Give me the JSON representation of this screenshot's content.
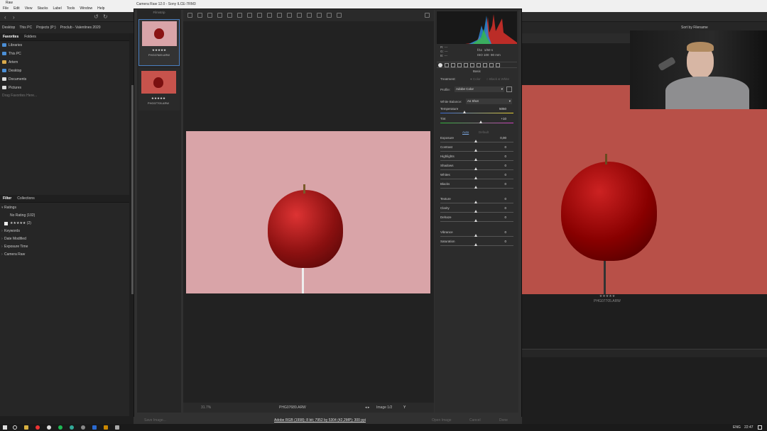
{
  "bridge": {
    "title": "Raw",
    "menu": [
      "File",
      "Edit",
      "View",
      "Stacks",
      "Label",
      "Tools",
      "Window",
      "Help"
    ],
    "path": [
      "Desktop",
      "This PC",
      "Projects (P:)",
      "Proclub - Valentines 2020"
    ],
    "left_tabs": [
      "Favorites",
      "Folders"
    ],
    "favorites": [
      "Libraries",
      "This PC",
      "Artem",
      "Desktop",
      "Documents",
      "Pictures"
    ],
    "drag_hint": "Drag Favorites Here...",
    "filter_tabs": [
      "Filter",
      "Collections"
    ],
    "ratings_label": "Ratings",
    "no_rating": "No Rating (102)",
    "five_star": "★★★★★ (2)",
    "filter_groups": [
      "Keywords",
      "Date Modified",
      "Exposure Time",
      "Camera Raw"
    ],
    "sort_label": "Sort by Filename",
    "preview_stars": "★★★★★",
    "preview_filename": "PHG07705.ARW"
  },
  "cr": {
    "title": "Camera Raw 12.0  -  Sony ILCE-7RM3",
    "filmstrip_label": "Filmstrip",
    "thumbs": [
      {
        "stars": "★★★★★",
        "name": "PHG07689.ARW"
      },
      {
        "stars": "★★★★★",
        "name": "PHG07705.ARW"
      }
    ],
    "zoom": "31.7%",
    "filename": "PHG07689.ARW",
    "image_counter": "Image 1/2",
    "info": {
      "r": "R:",
      "g": "G:",
      "b": "B:",
      "dash": "---",
      "aperture": "f/11",
      "shutter": "1/50 s",
      "iso": "ISO 100",
      "lens": "90 mm"
    },
    "panel_title": "Basic",
    "treatment_label": "Treatment:",
    "color": "Color",
    "bw": "Black & White",
    "profile_label": "Profile:",
    "profile": "Adobe Color",
    "wb_label": "White Balance:",
    "wb": "As Shot",
    "temp": {
      "label": "Temperature",
      "value": "5050",
      "pos": 0.32
    },
    "tint": {
      "label": "Tint",
      "value": "+10",
      "pos": 0.55
    },
    "auto": "Auto",
    "default": "Default",
    "tone": [
      {
        "label": "Exposure",
        "value": "0,00"
      },
      {
        "label": "Contrast",
        "value": "0"
      },
      {
        "label": "Highlights",
        "value": "0"
      },
      {
        "label": "Shadows",
        "value": "0"
      },
      {
        "label": "Whites",
        "value": "0"
      },
      {
        "label": "Blacks",
        "value": "0"
      }
    ],
    "presence": [
      {
        "label": "Texture",
        "value": "0"
      },
      {
        "label": "Clarity",
        "value": "0"
      },
      {
        "label": "Dehaze",
        "value": "0"
      }
    ],
    "color_sliders": [
      {
        "label": "Vibrance",
        "value": "0"
      },
      {
        "label": "Saturation",
        "value": "0"
      }
    ],
    "save": "Save Image...",
    "workflow": "Adobe RGB (1998); 8 bit; 7952 by 5304 (42,2MP); 300 ppi",
    "open": "Open Image",
    "cancel": "Cancel",
    "done": "Done"
  },
  "taskbar": {
    "lang": "ENG",
    "time": "22:47"
  }
}
